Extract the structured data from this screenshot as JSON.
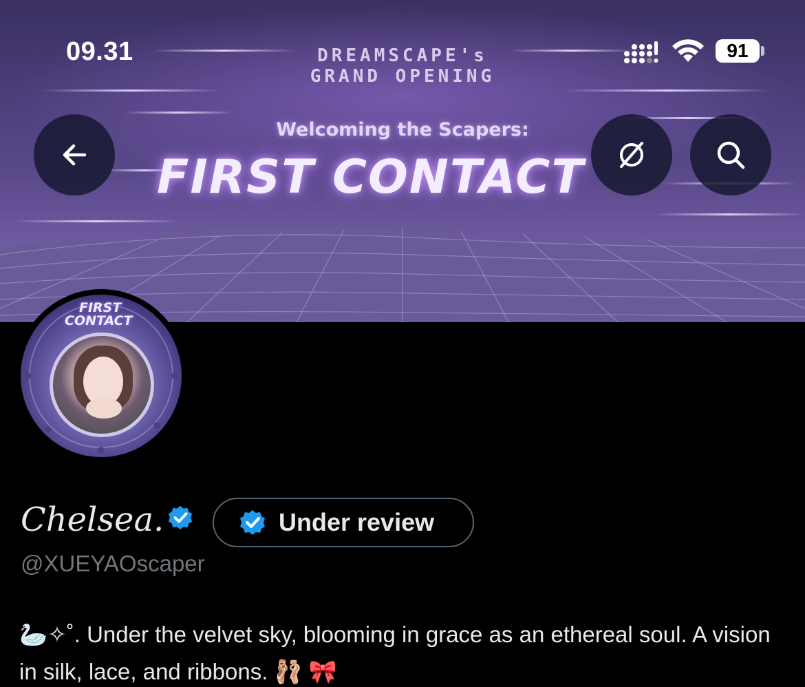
{
  "status_bar": {
    "time": "09.31",
    "battery": "91"
  },
  "banner": {
    "line1": "DREAMSCAPE's",
    "line2": "GRAND OPENING",
    "subtitle": "Welcoming the Scapers:",
    "headline": "FIRST CONTACT"
  },
  "avatar": {
    "label_line1": "FIRST",
    "label_line2": "CONTACT"
  },
  "profile": {
    "display_name": "Chelsea.",
    "handle": "@XUEYAOscaper",
    "verification_status": "Under review",
    "bio": "🦢✧˚. Under the velvet sky, blooming in grace as an ethereal soul. A vision in silk, lace, and ribbons. 🩰 🎀"
  },
  "icons": {
    "back": "arrow-left-icon",
    "hide": "eye-slash-icon",
    "search": "search-icon",
    "verified": "verified-badge-icon"
  },
  "colors": {
    "verified_blue": "#1d9bf0",
    "background": "#000000",
    "secondary_text": "#71767b"
  }
}
